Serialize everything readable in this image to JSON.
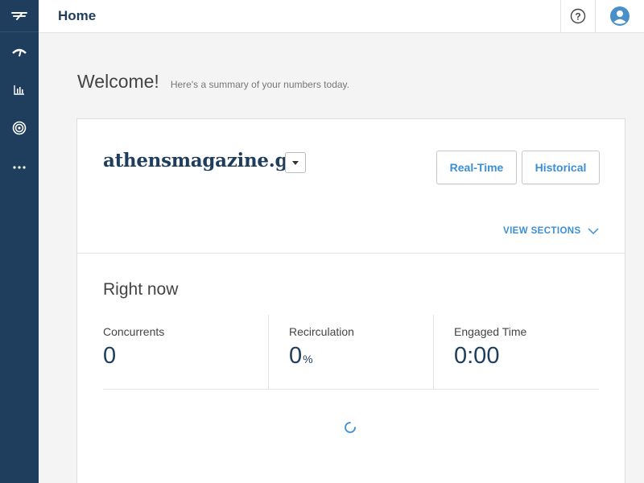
{
  "header": {
    "title": "Home"
  },
  "welcome": {
    "title": "Welcome!",
    "subtitle": "Here's a summary of your numbers today."
  },
  "site": {
    "name": "athensmagazine.gr"
  },
  "buttons": {
    "realtime": "Real-Time",
    "historical": "Historical"
  },
  "view_sections": "VIEW SECTIONS",
  "right_now": {
    "title": "Right now",
    "metrics": [
      {
        "label": "Concurrents",
        "value": "0",
        "unit": ""
      },
      {
        "label": "Recirculation",
        "value": "0",
        "unit": "%"
      },
      {
        "label": "Engaged Time",
        "value": "0:00",
        "unit": ""
      }
    ]
  },
  "colors": {
    "sidebar": "#1f3d5c",
    "accent": "#3b8fd6",
    "avatar": "#4a8fc7"
  },
  "icons": [
    "logo-icon",
    "gauge-icon",
    "bar-chart-icon",
    "target-icon",
    "more-icon",
    "help-icon",
    "user-avatar-icon",
    "chevron-down-icon",
    "caret-down-icon",
    "loading-spinner-icon"
  ]
}
